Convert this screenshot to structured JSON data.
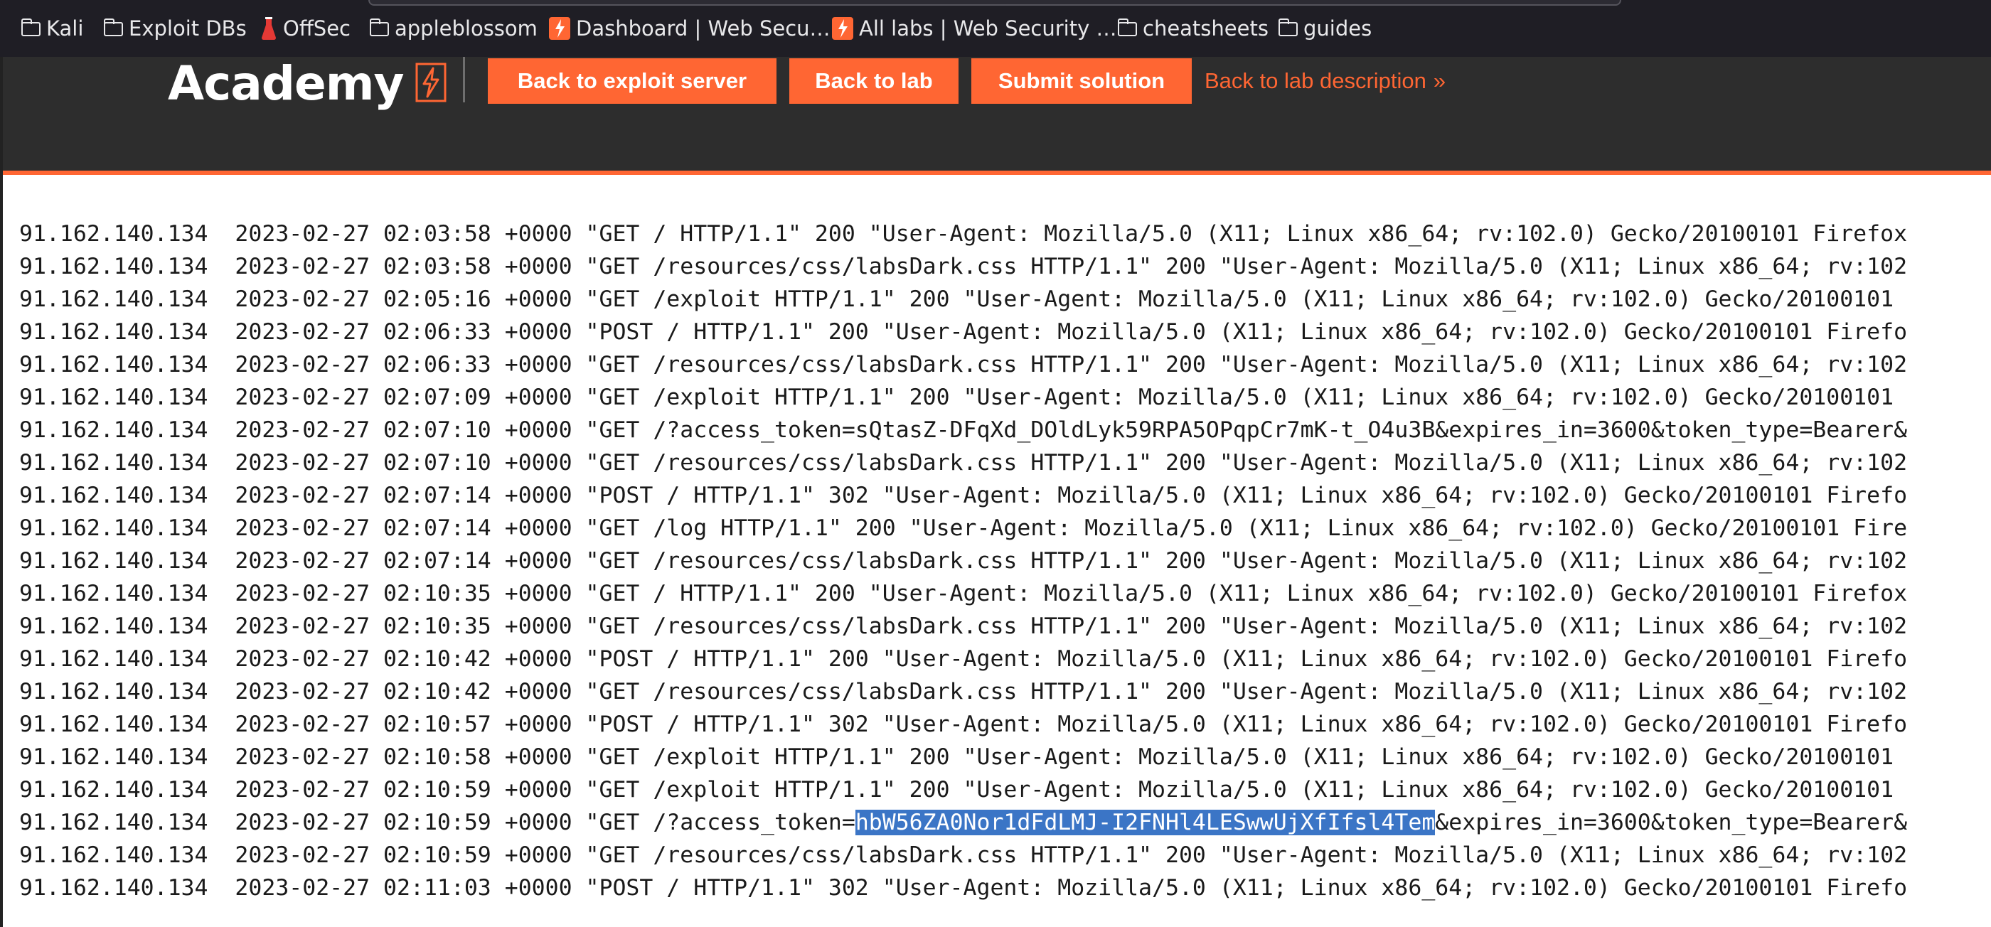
{
  "bookmarks": [
    {
      "label": "Kali",
      "icon": "folder-icon"
    },
    {
      "label": "Exploit DBs",
      "icon": "folder-icon"
    },
    {
      "label": "OffSec",
      "icon": "flask-icon"
    },
    {
      "label": "appleblossom",
      "icon": "folder-icon"
    },
    {
      "label": "Dashboard | Web Secu…",
      "icon": "portswigger-icon"
    },
    {
      "label": "All labs | Web Security …",
      "icon": "portswigger-icon"
    },
    {
      "label": "cheatsheets",
      "icon": "folder-icon"
    },
    {
      "label": "guides",
      "icon": "folder-icon"
    }
  ],
  "header": {
    "logo_text": "Academy",
    "back_to_exploit_server": "Back to exploit server",
    "back_to_lab": "Back to lab",
    "submit_solution": "Submit solution",
    "back_to_lab_description": "Back to lab description",
    "chevron": "»"
  },
  "colors": {
    "accent": "#ff6633",
    "header_bg": "#2d2d2d",
    "selection": "#3b75c6"
  },
  "log": [
    {
      "text": "91.162.140.134  2023-02-27 02:03:58 +0000 \"GET / HTTP/1.1\" 200 \"User-Agent: Mozilla/5.0 (X11; Linux x86_64; rv:102.0) Gecko/20100101 Firefox"
    },
    {
      "text": "91.162.140.134  2023-02-27 02:03:58 +0000 \"GET /resources/css/labsDark.css HTTP/1.1\" 200 \"User-Agent: Mozilla/5.0 (X11; Linux x86_64; rv:102"
    },
    {
      "text": "91.162.140.134  2023-02-27 02:05:16 +0000 \"GET /exploit HTTP/1.1\" 200 \"User-Agent: Mozilla/5.0 (X11; Linux x86_64; rv:102.0) Gecko/20100101"
    },
    {
      "text": "91.162.140.134  2023-02-27 02:06:33 +0000 \"POST / HTTP/1.1\" 200 \"User-Agent: Mozilla/5.0 (X11; Linux x86_64; rv:102.0) Gecko/20100101 Firefo"
    },
    {
      "text": "91.162.140.134  2023-02-27 02:06:33 +0000 \"GET /resources/css/labsDark.css HTTP/1.1\" 200 \"User-Agent: Mozilla/5.0 (X11; Linux x86_64; rv:102"
    },
    {
      "text": "91.162.140.134  2023-02-27 02:07:09 +0000 \"GET /exploit HTTP/1.1\" 200 \"User-Agent: Mozilla/5.0 (X11; Linux x86_64; rv:102.0) Gecko/20100101"
    },
    {
      "text": "91.162.140.134  2023-02-27 02:07:10 +0000 \"GET /?access_token=sQtasZ-DFqXd_DOldLyk59RPA5OPqpCr7mK-t_O4u3B&expires_in=3600&token_type=Bearer&"
    },
    {
      "text": "91.162.140.134  2023-02-27 02:07:10 +0000 \"GET /resources/css/labsDark.css HTTP/1.1\" 200 \"User-Agent: Mozilla/5.0 (X11; Linux x86_64; rv:102"
    },
    {
      "text": "91.162.140.134  2023-02-27 02:07:14 +0000 \"POST / HTTP/1.1\" 302 \"User-Agent: Mozilla/5.0 (X11; Linux x86_64; rv:102.0) Gecko/20100101 Firefo"
    },
    {
      "text": "91.162.140.134  2023-02-27 02:07:14 +0000 \"GET /log HTTP/1.1\" 200 \"User-Agent: Mozilla/5.0 (X11; Linux x86_64; rv:102.0) Gecko/20100101 Fire"
    },
    {
      "text": "91.162.140.134  2023-02-27 02:07:14 +0000 \"GET /resources/css/labsDark.css HTTP/1.1\" 200 \"User-Agent: Mozilla/5.0 (X11; Linux x86_64; rv:102"
    },
    {
      "text": "91.162.140.134  2023-02-27 02:10:35 +0000 \"GET / HTTP/1.1\" 200 \"User-Agent: Mozilla/5.0 (X11; Linux x86_64; rv:102.0) Gecko/20100101 Firefox"
    },
    {
      "text": "91.162.140.134  2023-02-27 02:10:35 +0000 \"GET /resources/css/labsDark.css HTTP/1.1\" 200 \"User-Agent: Mozilla/5.0 (X11; Linux x86_64; rv:102"
    },
    {
      "text": "91.162.140.134  2023-02-27 02:10:42 +0000 \"POST / HTTP/1.1\" 200 \"User-Agent: Mozilla/5.0 (X11; Linux x86_64; rv:102.0) Gecko/20100101 Firefo"
    },
    {
      "text": "91.162.140.134  2023-02-27 02:10:42 +0000 \"GET /resources/css/labsDark.css HTTP/1.1\" 200 \"User-Agent: Mozilla/5.0 (X11; Linux x86_64; rv:102"
    },
    {
      "text": "91.162.140.134  2023-02-27 02:10:57 +0000 \"POST / HTTP/1.1\" 302 \"User-Agent: Mozilla/5.0 (X11; Linux x86_64; rv:102.0) Gecko/20100101 Firefo"
    },
    {
      "text": "91.162.140.134  2023-02-27 02:10:58 +0000 \"GET /exploit HTTP/1.1\" 200 \"User-Agent: Mozilla/5.0 (X11; Linux x86_64; rv:102.0) Gecko/20100101"
    },
    {
      "text": "91.162.140.134  2023-02-27 02:10:59 +0000 \"GET /exploit HTTP/1.1\" 200 \"User-Agent: Mozilla/5.0 (X11; Linux x86_64; rv:102.0) Gecko/20100101"
    },
    {
      "pre": "91.162.140.134  2023-02-27 02:10:59 +0000 \"GET /?access_token=",
      "selected": "hbW56ZA0Nor1dFdLMJ-I2FNHl4LESwwUjXfIfsl4Tem",
      "post": "&expires_in=3600&token_type=Bearer&"
    },
    {
      "text": "91.162.140.134  2023-02-27 02:10:59 +0000 \"GET /resources/css/labsDark.css HTTP/1.1\" 200 \"User-Agent: Mozilla/5.0 (X11; Linux x86_64; rv:102"
    },
    {
      "text": "91.162.140.134  2023-02-27 02:11:03 +0000 \"POST / HTTP/1.1\" 302 \"User-Agent: Mozilla/5.0 (X11; Linux x86_64; rv:102.0) Gecko/20100101 Firefo"
    }
  ]
}
